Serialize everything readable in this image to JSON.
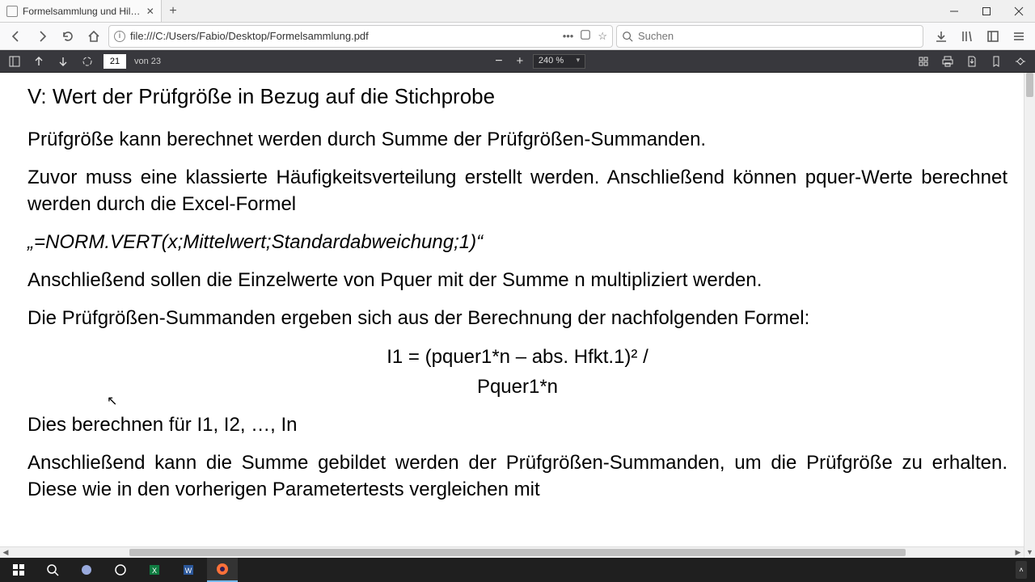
{
  "tab": {
    "title": "Formelsammlung und Hilfsmittel S…"
  },
  "url": "file:///C:/Users/Fabio/Desktop/Formelsammlung.pdf",
  "search": {
    "placeholder": "Suchen"
  },
  "pdf_toolbar": {
    "page_current": "21",
    "page_total_label": "von 23",
    "zoom_label": "240 %"
  },
  "doc": {
    "heading": "V: Wert der Prüfgröße in Bezug auf die Stichprobe",
    "p1": "Prüfgröße kann berechnet werden durch Summe der Prüfgrößen-Summanden.",
    "p2": "Zuvor muss eine klassierte Häufigkeitsverteilung erstellt werden. Anschließend können pquer-Werte berechnet werden durch die Excel-Formel",
    "formula1": "„=NORM.VERT(x;Mittelwert;Standardabweichung;1)“",
    "p3": "Anschließend sollen die Einzelwerte von Pquer mit der Summe n multipliziert werden.",
    "p4": "Die Prüfgrößen-Summanden ergeben sich aus der Berechnung der nachfolgenden Formel:",
    "formula2a": "I1 = (pquer1*n – abs. Hfkt.1)² /",
    "formula2b": "Pquer1*n",
    "p5": "Dies berechnen für I1, I2, …, In",
    "p6": "Anschließend kann die Summe gebildet werden der Prüfgrößen-Summanden, um die Prüfgröße zu erhalten. Diese wie in den vorherigen Parametertests vergleichen mit"
  }
}
